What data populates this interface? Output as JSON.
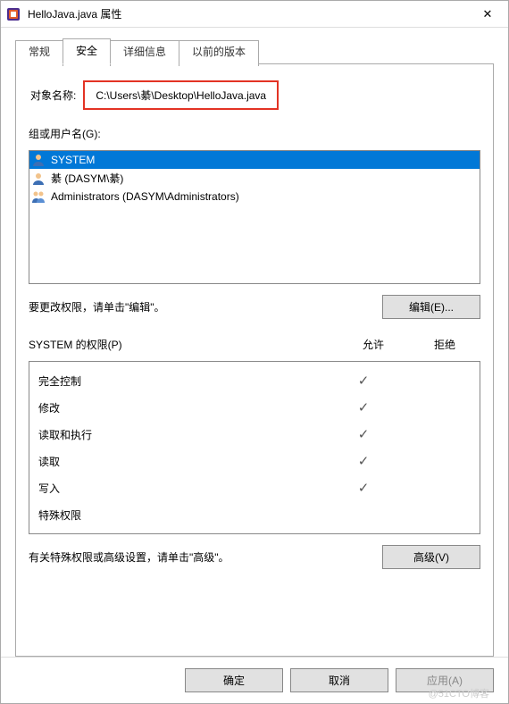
{
  "window": {
    "title": "HelloJava.java 属性",
    "close_glyph": "✕"
  },
  "tabs": {
    "general": "常规",
    "security": "安全",
    "details": "详细信息",
    "previous": "以前的版本",
    "active": "security"
  },
  "object": {
    "label": "对象名称:",
    "value": "C:\\Users\\綦\\Desktop\\HelloJava.java"
  },
  "groups": {
    "label": "组或用户名(G):",
    "items": [
      {
        "name": "SYSTEM",
        "icon": "single",
        "selected": true
      },
      {
        "name": "綦 (DASYM\\綦)",
        "icon": "single",
        "selected": false
      },
      {
        "name": "Administrators (DASYM\\Administrators)",
        "icon": "group",
        "selected": false
      }
    ]
  },
  "edit": {
    "hint": "要更改权限，请单击\"编辑\"。",
    "button": "编辑(E)..."
  },
  "permissions": {
    "header_name": "SYSTEM 的权限(P)",
    "col_allow": "允许",
    "col_deny": "拒绝",
    "rows": [
      {
        "name": "完全控制",
        "allow": true,
        "deny": false
      },
      {
        "name": "修改",
        "allow": true,
        "deny": false
      },
      {
        "name": "读取和执行",
        "allow": true,
        "deny": false
      },
      {
        "name": "读取",
        "allow": true,
        "deny": false
      },
      {
        "name": "写入",
        "allow": true,
        "deny": false
      },
      {
        "name": "特殊权限",
        "allow": false,
        "deny": false
      }
    ]
  },
  "advanced": {
    "hint": "有关特殊权限或高级设置，请单击\"高级\"。",
    "button": "高级(V)"
  },
  "footer": {
    "ok": "确定",
    "cancel": "取消",
    "apply": "应用(A)"
  },
  "watermark": "@51CTO博客",
  "glyphs": {
    "check": "✓"
  }
}
